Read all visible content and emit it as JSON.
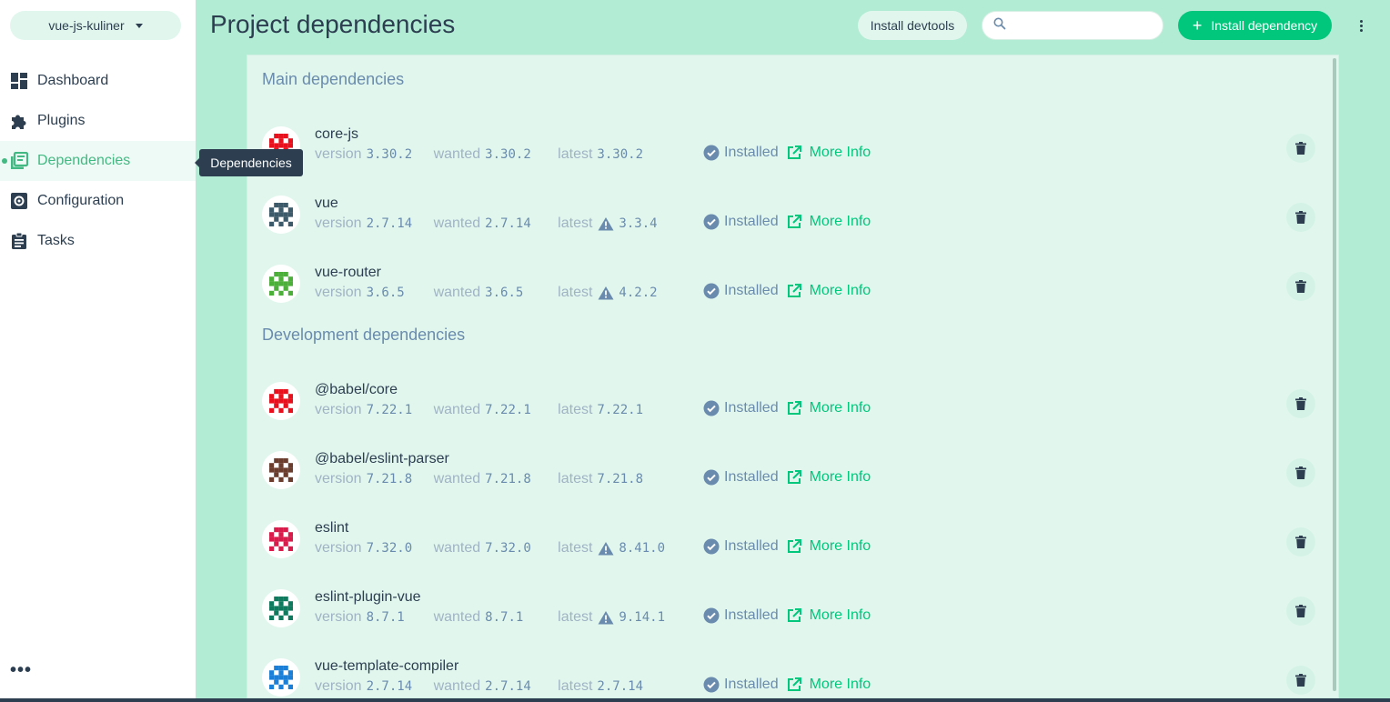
{
  "sidebar": {
    "project_name": "vue-js-kuliner",
    "items": [
      {
        "label": "Dashboard",
        "icon": "dashboard-icon"
      },
      {
        "label": "Plugins",
        "icon": "puzzle-icon"
      },
      {
        "label": "Dependencies",
        "icon": "library-icon",
        "active": true
      },
      {
        "label": "Configuration",
        "icon": "settings-icon"
      },
      {
        "label": "Tasks",
        "icon": "clipboard-icon"
      }
    ],
    "more_label": "•••"
  },
  "tooltip": "Dependencies",
  "header": {
    "title": "Project dependencies",
    "devtools_label": "Install devtools",
    "search_placeholder": "",
    "install_label": "Install dependency"
  },
  "sections": {
    "main_title": "Main dependencies",
    "dev_title": "Development dependencies"
  },
  "labels": {
    "version": "version",
    "wanted": "wanted",
    "latest": "latest",
    "installed": "Installed",
    "more_info": "More Info"
  },
  "main_dependencies": [
    {
      "name": "core-js",
      "version": "3.30.2",
      "wanted": "3.30.2",
      "latest": "3.30.2",
      "outdated": false,
      "color": "#e8101c"
    },
    {
      "name": "vue",
      "version": "2.7.14",
      "wanted": "2.7.14",
      "latest": "3.3.4",
      "outdated": true,
      "color": "#3d5a6a"
    },
    {
      "name": "vue-router",
      "version": "3.6.5",
      "wanted": "3.6.5",
      "latest": "4.2.2",
      "outdated": true,
      "color": "#4caf3a"
    }
  ],
  "dev_dependencies": [
    {
      "name": "@babel/core",
      "version": "7.22.1",
      "wanted": "7.22.1",
      "latest": "7.22.1",
      "outdated": false,
      "color": "#e8101c"
    },
    {
      "name": "@babel/eslint-parser",
      "version": "7.21.8",
      "wanted": "7.21.8",
      "latest": "7.21.8",
      "outdated": false,
      "color": "#6b3d2e"
    },
    {
      "name": "eslint",
      "version": "7.32.0",
      "wanted": "7.32.0",
      "latest": "8.41.0",
      "outdated": true,
      "color": "#d81b4a"
    },
    {
      "name": "eslint-plugin-vue",
      "version": "8.7.1",
      "wanted": "8.7.1",
      "latest": "9.14.1",
      "outdated": true,
      "color": "#0f7a5e"
    },
    {
      "name": "vue-template-compiler",
      "version": "2.7.14",
      "wanted": "2.7.14",
      "latest": "2.7.14",
      "outdated": false,
      "color": "#1b7fd8"
    }
  ],
  "colors": {
    "accent": "#00c77c",
    "main_bg": "#b2ecd5",
    "panel_bg": "#e1f7ee",
    "text": "#2c3e50",
    "muted": "#6a8bad"
  }
}
